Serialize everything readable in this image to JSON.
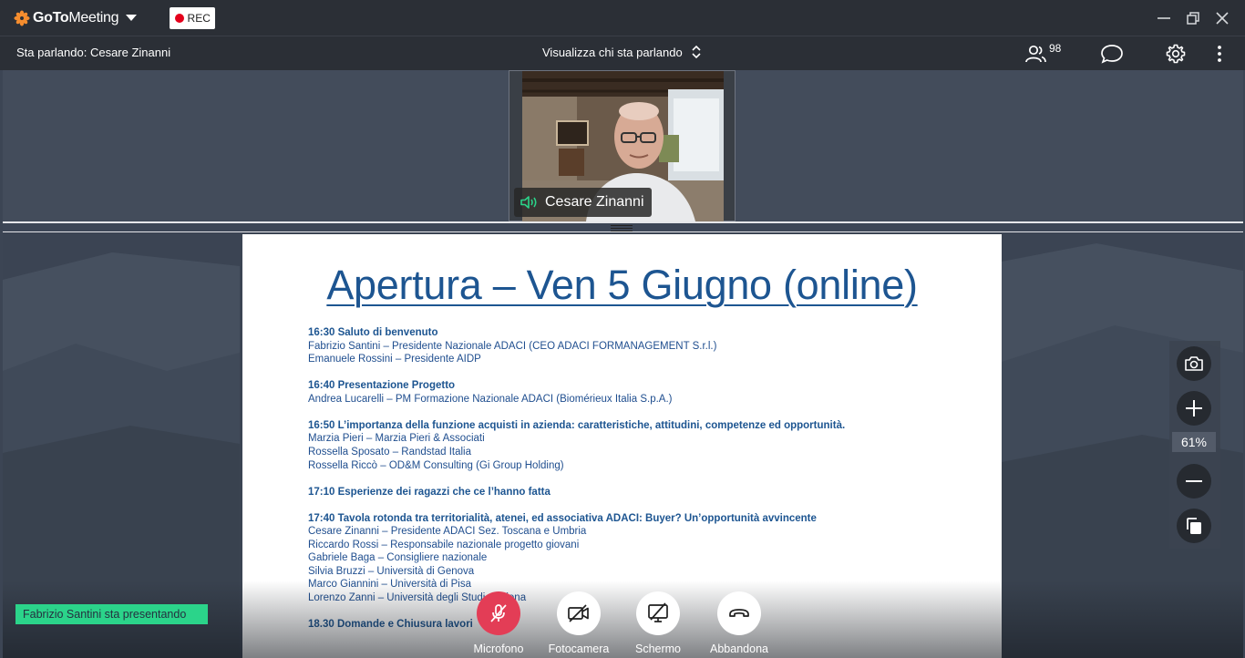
{
  "titlebar": {
    "app_name_bold": "GoTo",
    "app_name_light": "Meeting",
    "rec_label": "REC"
  },
  "toolbar": {
    "speaking": "Sta parlando: Cesare Zinanni",
    "view_mode": "Visualizza chi sta parlando",
    "attendees": "98"
  },
  "video": {
    "participant_name": "Cesare Zinanni"
  },
  "slide": {
    "title": "Apertura – Ven 5 Giugno (online)",
    "blocks": [
      {
        "head": "16:30 Saluto di benvenuto",
        "lines": [
          "Fabrizio Santini – Presidente Nazionale ADACI (CEO ADACI FORMANAGEMENT S.r.l.)",
          "Emanuele Rossini – Presidente AIDP"
        ]
      },
      {
        "head": "16:40 Presentazione Progetto",
        "lines": [
          "Andrea Lucarelli – PM Formazione Nazionale ADACI (Biomérieux Italia S.p.A.)"
        ]
      },
      {
        "head": "16:50   L’importanza della funzione acquisti in azienda: caratteristiche, attitudini, competenze ed opportunità.",
        "lines": [
          "Marzia Pieri – Marzia Pieri & Associati",
          "Rossella Sposato – Randstad Italia",
          "Rossella Riccò – OD&M Consulting (Gi Group Holding)"
        ]
      },
      {
        "head": "17:10   Esperienze dei ragazzi che ce l’hanno fatta",
        "lines": []
      },
      {
        "head": "17:40  Tavola rotonda tra territorialità, atenei, ed associativa ADACI: Buyer? Un’opportunità avvincente",
        "lines": [
          "Cesare Zinanni – Presidente ADACI Sez. Toscana e Umbria",
          "Riccardo Rossi – Responsabile nazionale progetto giovani",
          "Gabriele Baga – Consigliere nazionale",
          "Silvia Bruzzi – Università di Genova",
          "Marco Giannini – Università di Pisa",
          "Lorenzo Zanni – Università degli Studi di Siena"
        ]
      },
      {
        "head": "18.30   Domande e Chiusura lavori",
        "lines": []
      }
    ]
  },
  "zoom": {
    "percent": "61%"
  },
  "presenter": "Fabrizio Santini sta presentando",
  "controls": {
    "microphone": "Microfono",
    "camera": "Fotocamera",
    "screen": "Schermo",
    "leave": "Abbandona"
  },
  "icons": {
    "logo": "gotomeeting-flower-icon",
    "record": "record-dot-icon",
    "minimize": "minimize-icon",
    "restore": "restore-icon",
    "close": "close-icon",
    "sort": "chevron-up-down-icon",
    "attendees": "people-icon",
    "chat": "chat-bubble-icon",
    "settings": "gear-icon",
    "more": "kebab-menu-icon",
    "speaker": "speaker-volume-icon",
    "snapshot": "camera-snapshot-icon",
    "zoom_in": "plus-icon",
    "zoom_out": "minus-icon",
    "copy": "copy-icon",
    "mic_off": "microphone-muted-icon",
    "cam_off": "camera-off-icon",
    "screen_off": "screen-share-off-icon",
    "hangup": "hang-up-icon"
  },
  "colors": {
    "accent_orange": "#f68d2e",
    "rec_red": "#e4001b",
    "presenter_green": "#2bd48a",
    "mic_red": "#e33d56",
    "slide_blue": "#1d5591"
  }
}
